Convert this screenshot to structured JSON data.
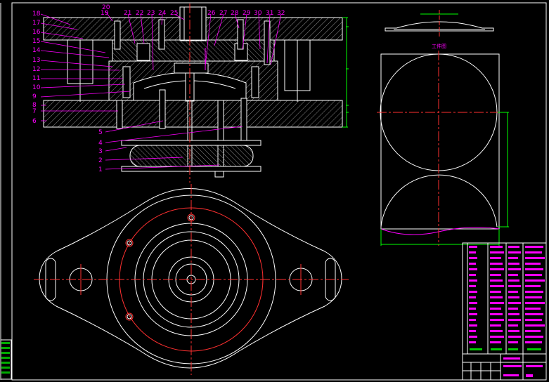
{
  "colors": {
    "background": "#000000",
    "outline": "#ffffff",
    "centerline": "#ff3030",
    "label": "#ff00ff",
    "dimension": "#00ff00",
    "hatch": "#9a9a9a"
  },
  "top_view_numbers": [
    "20",
    "19",
    "21",
    "22",
    "23",
    "24",
    "25",
    "26",
    "27",
    "28",
    "29",
    "30",
    "31",
    "32"
  ],
  "left_callouts": [
    "18",
    "17",
    "16",
    "15",
    "14",
    "13",
    "12",
    "11",
    "10",
    "9",
    "8",
    "7",
    "6",
    "5",
    "4",
    "3",
    "2",
    "1"
  ],
  "view_label": "工件图",
  "icons": {
    "bolt_hole": "bolt-hole-icon",
    "center_mark": "center-mark-icon"
  }
}
